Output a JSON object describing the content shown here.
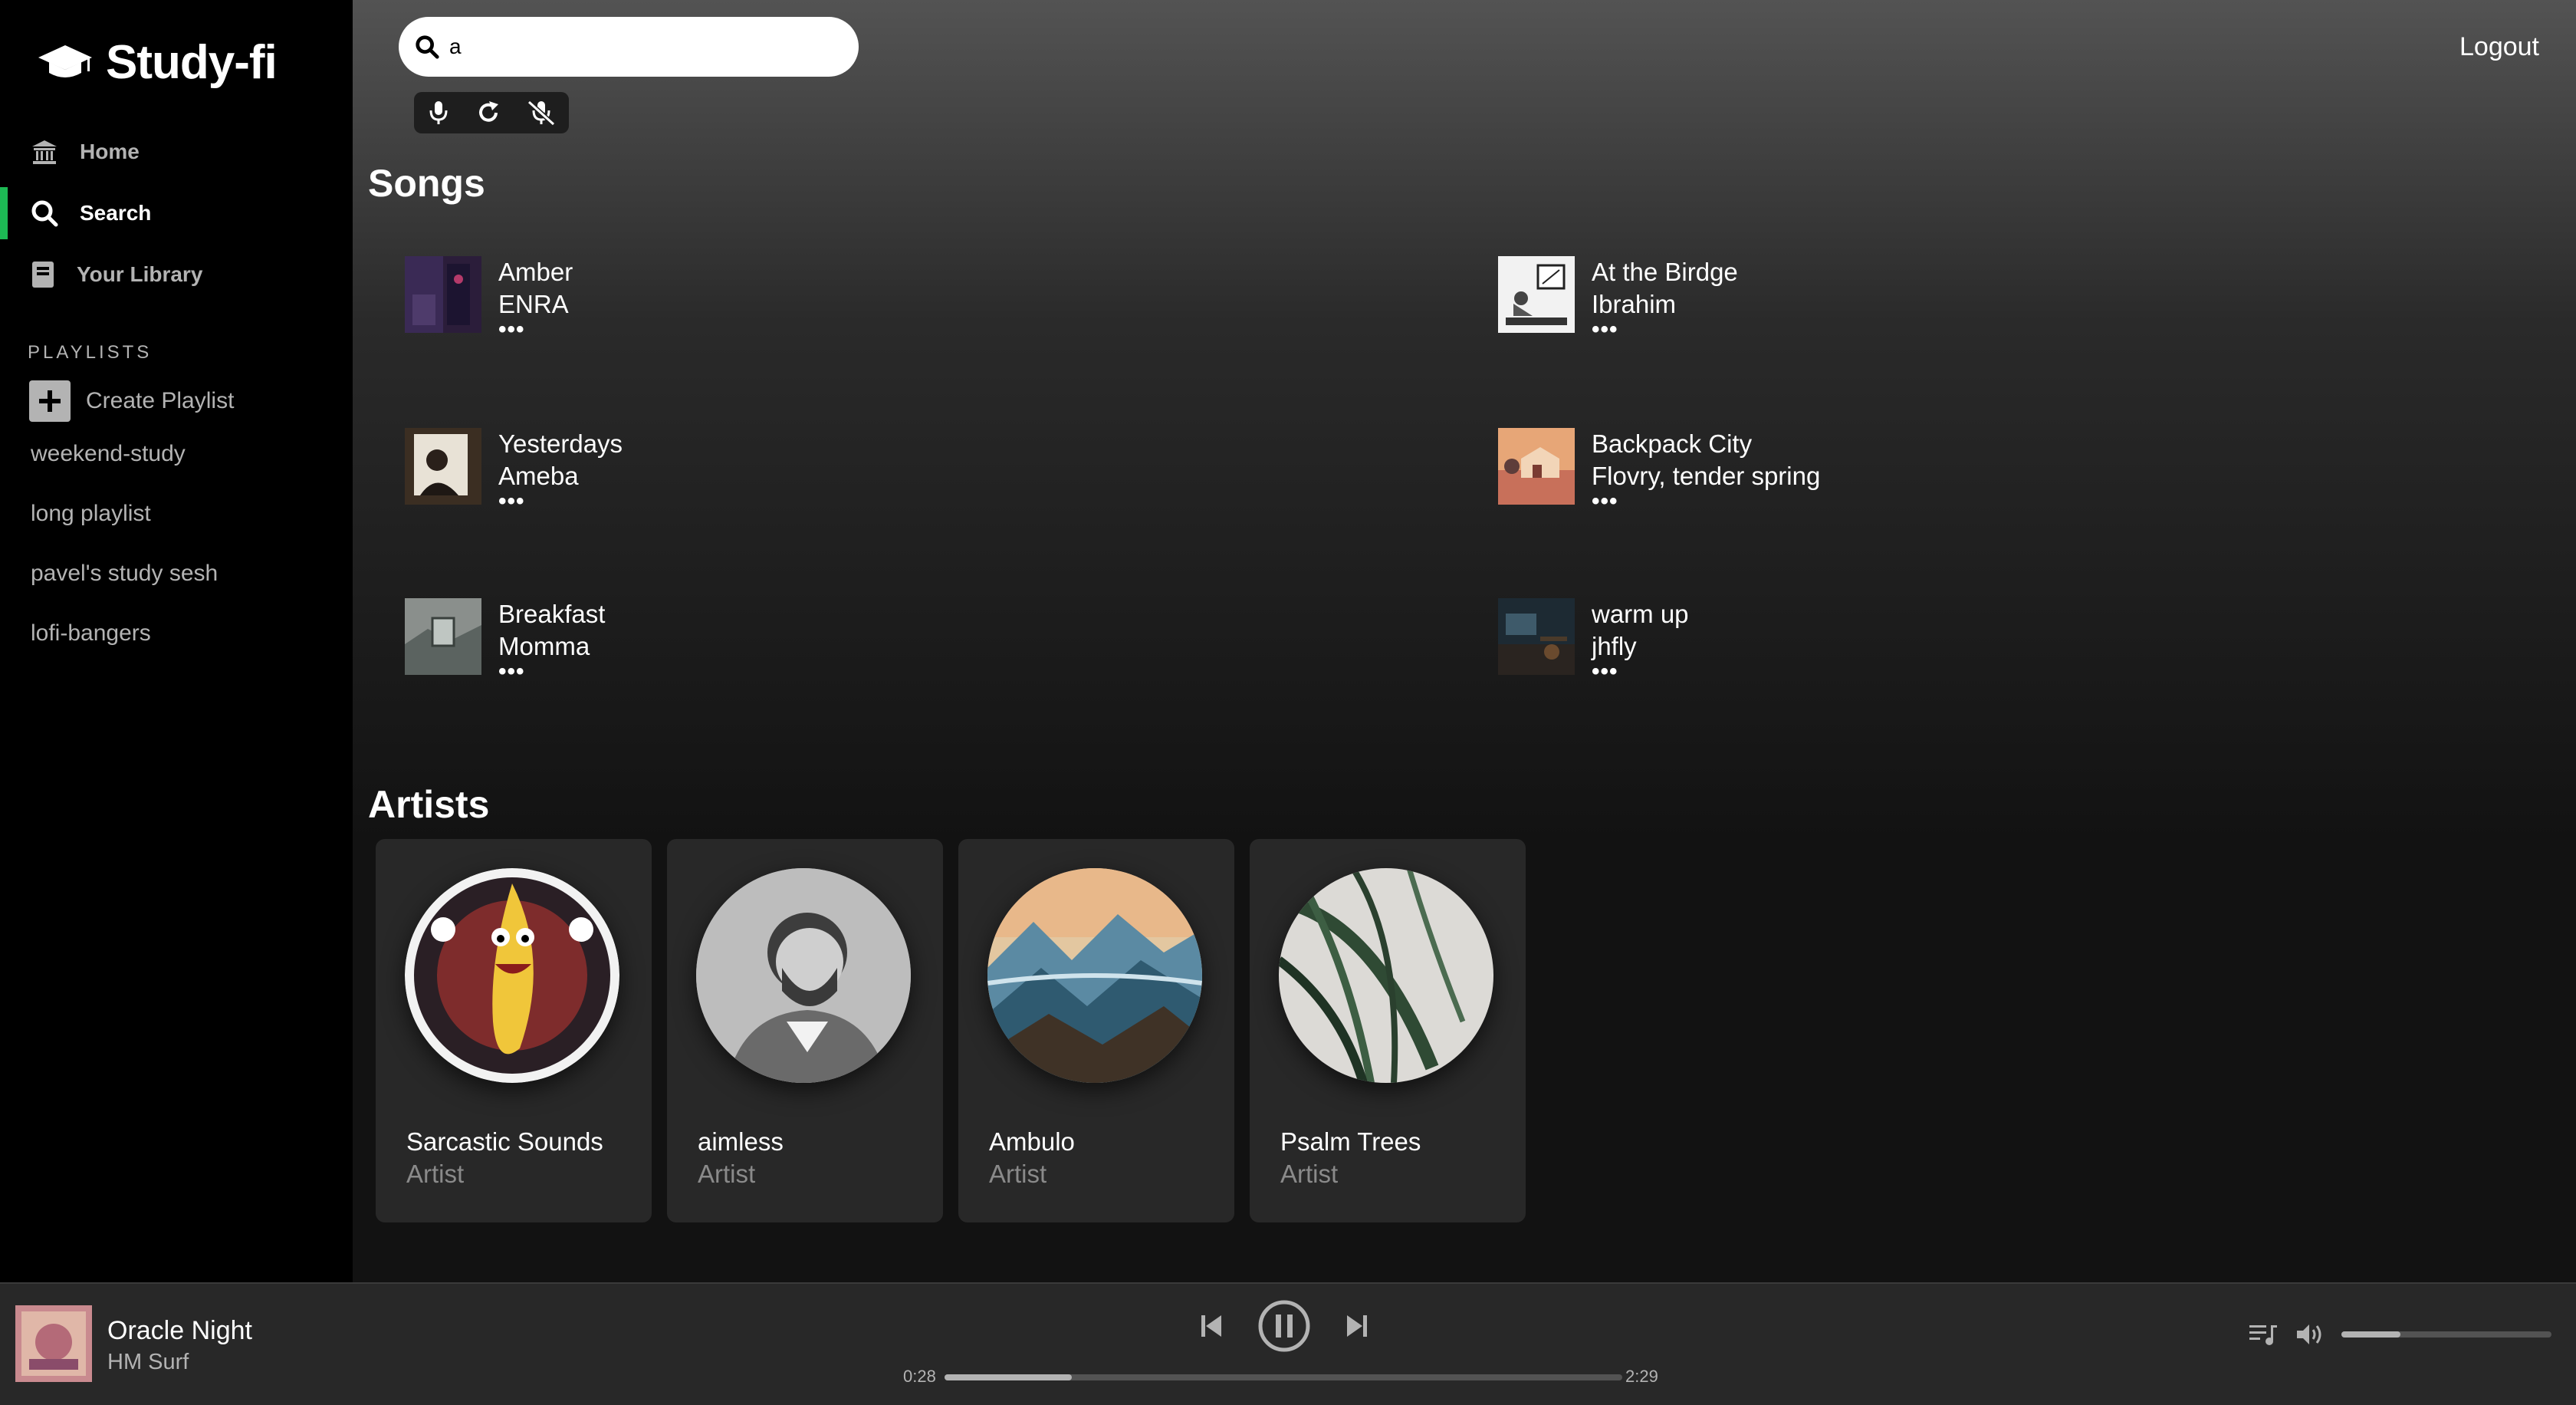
{
  "app": {
    "name": "Study-fi"
  },
  "sidebar": {
    "nav": [
      {
        "label": "Home",
        "icon": "home-icon"
      },
      {
        "label": "Search",
        "icon": "search-icon",
        "active": true
      },
      {
        "label": "Your Library",
        "icon": "library-icon"
      }
    ],
    "playlists_header": "PLAYLISTS",
    "create_playlist": "Create Playlist",
    "playlists": [
      "weekend-study",
      "long playlist",
      "pavel's study sesh",
      "lofi-bangers"
    ]
  },
  "header": {
    "search_value": "a",
    "logout": "Logout"
  },
  "songs": {
    "title": "Songs",
    "items": [
      {
        "title": "Amber",
        "artist": "ENRA",
        "more": "•••"
      },
      {
        "title": "At the Birdge",
        "artist": "Ibrahim",
        "more": "•••"
      },
      {
        "title": "Yesterdays",
        "artist": "Ameba",
        "more": "•••"
      },
      {
        "title": "Backpack City",
        "artist": "Flovry, tender spring",
        "more": "•••"
      },
      {
        "title": "Breakfast",
        "artist": "Momma",
        "more": "•••"
      },
      {
        "title": "warm up",
        "artist": "jhfly",
        "more": "•••"
      }
    ]
  },
  "artists": {
    "title": "Artists",
    "items": [
      {
        "name": "Sarcastic Sounds",
        "type": "Artist"
      },
      {
        "name": "aimless",
        "type": "Artist"
      },
      {
        "name": "Ambulo",
        "type": "Artist"
      },
      {
        "name": "Psalm Trees",
        "type": "Artist"
      }
    ]
  },
  "player": {
    "title": "Oracle Night",
    "artist": "HM Surf",
    "elapsed": "0:28",
    "duration": "2:29",
    "progress_fraction": 0.188,
    "volume_fraction": 0.28
  },
  "colors": {
    "accent": "#1db954",
    "sidebar_bg": "#000000",
    "player_bg": "#282828"
  }
}
